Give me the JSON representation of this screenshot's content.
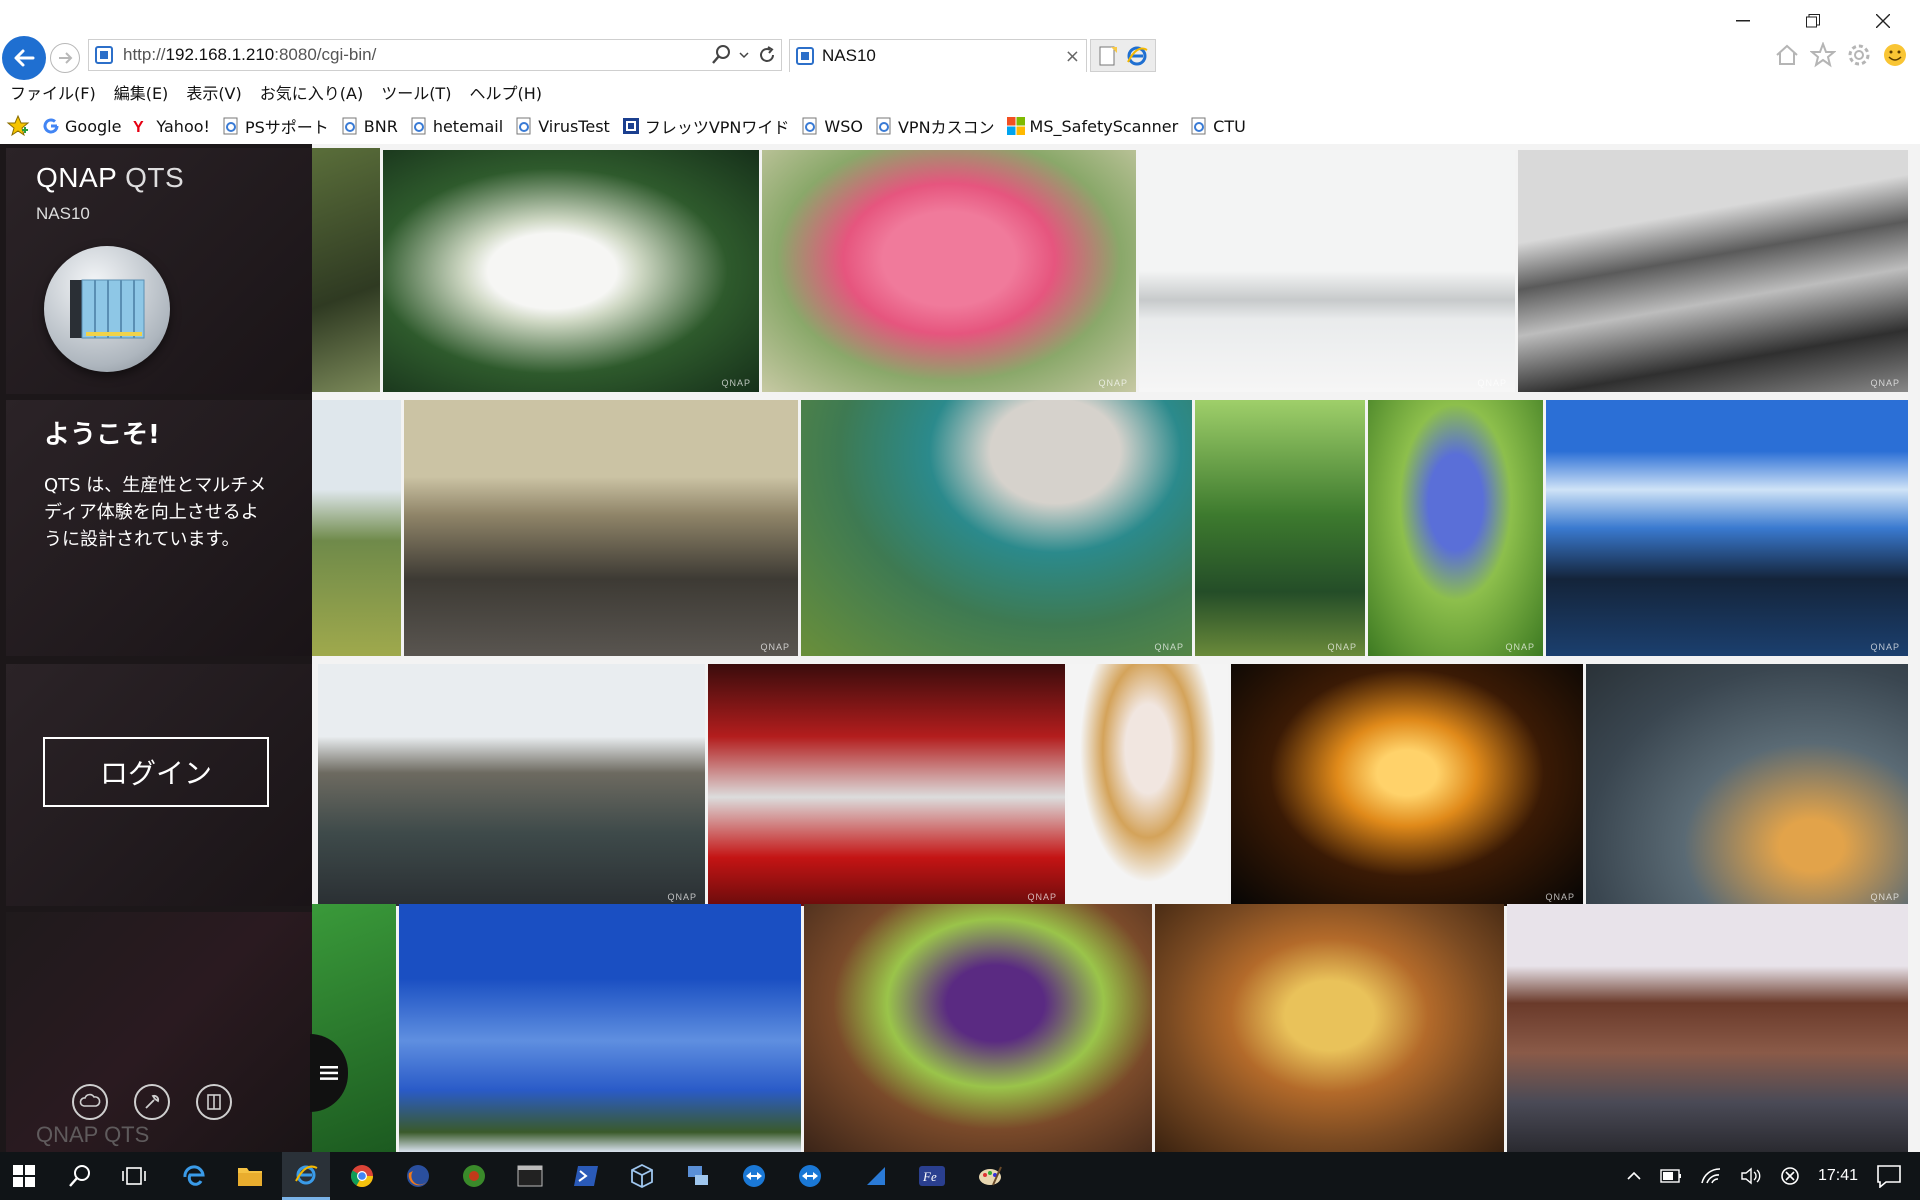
{
  "browser": {
    "address": {
      "scheme": "http://",
      "host": "192.168.1.210",
      "rest": ":8080/cgi-bin/"
    },
    "tab_title": "NAS10",
    "tab_close": "×"
  },
  "menu": [
    "ファイル(F)",
    "編集(E)",
    "表示(V)",
    "お気に入り(A)",
    "ツール(T)",
    "ヘルプ(H)"
  ],
  "favorites": [
    {
      "label": "Google",
      "icon": "google-icon",
      "color": "#4285f4"
    },
    {
      "label": "Yahoo!",
      "icon": "yahoo-icon",
      "color": "#e60012"
    },
    {
      "label": "PSサポート",
      "icon": "ie-page-icon",
      "color": "#3a7bd5"
    },
    {
      "label": "BNR",
      "icon": "ie-page-icon",
      "color": "#3a7bd5"
    },
    {
      "label": "hetemail",
      "icon": "ie-page-icon",
      "color": "#3a7bd5"
    },
    {
      "label": "VirusTest",
      "icon": "ie-page-icon",
      "color": "#3a7bd5"
    },
    {
      "label": "フレッツVPNワイド",
      "icon": "flets-icon",
      "color": "#1b3f8f"
    },
    {
      "label": "WSO",
      "icon": "ie-page-icon",
      "color": "#3a7bd5"
    },
    {
      "label": "VPNカスコン",
      "icon": "ie-page-icon",
      "color": "#3a7bd5"
    },
    {
      "label": "MS_SafetyScanner",
      "icon": "microsoft-icon",
      "color": "#f25022"
    },
    {
      "label": "CTU",
      "icon": "ie-page-icon",
      "color": "#3a7bd5"
    }
  ],
  "qts": {
    "brand_main": "QNAP",
    "brand_sub": "QTS",
    "device_name": "NAS10",
    "welcome_title": "ようこそ!",
    "welcome_text": "QTS は、生産性とマルチメディア体験を向上させるように設計されています。",
    "login_label": "ログイン",
    "ghost_brand": "QNAP QTS"
  },
  "watermark": "QNAP",
  "taskbar": {
    "time": "17:41"
  },
  "colors": {
    "ie_blue": "#1f6fd1",
    "sidebar_bg": "#1c1719",
    "taskbar_bg": "#101417"
  }
}
